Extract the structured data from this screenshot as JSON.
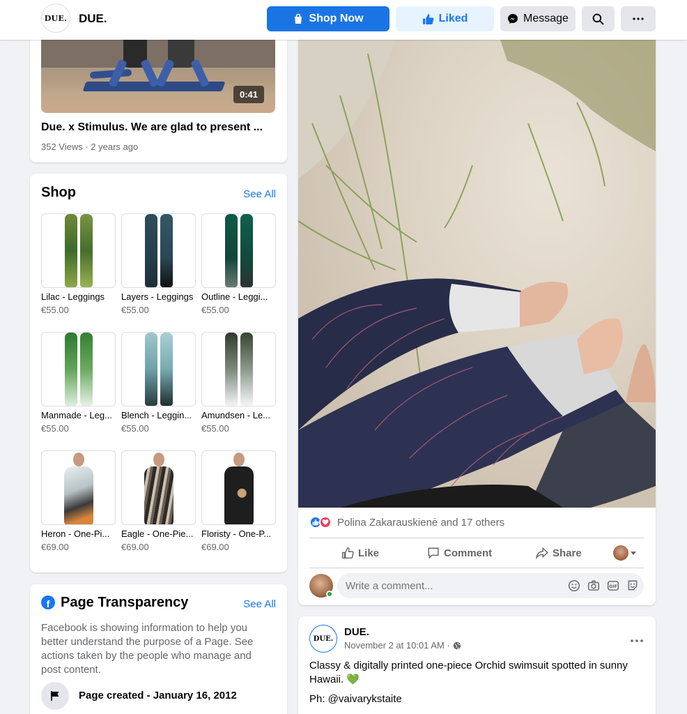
{
  "header": {
    "logo_text": "DUE.",
    "page_name": "DUE.",
    "shop_now": "Shop Now",
    "liked": "Liked",
    "message": "Message"
  },
  "video": {
    "duration": "0:41",
    "title": "Due. x Stimulus. We are glad to present ...",
    "meta": "352 Views · 2 years ago"
  },
  "shop": {
    "title": "Shop",
    "see_all": "See All",
    "products": [
      {
        "name": "Lilac - Leggings",
        "price": "€55.00"
      },
      {
        "name": "Layers - Leggings",
        "price": "€55.00"
      },
      {
        "name": "Outline - Leggi...",
        "price": "€55.00"
      },
      {
        "name": "Manmade - Leg...",
        "price": "€55.00"
      },
      {
        "name": "Blench - Leggin...",
        "price": "€55.00"
      },
      {
        "name": "Amundsen - Le...",
        "price": "€55.00"
      },
      {
        "name": "Heron - One-Pi...",
        "price": "€69.00"
      },
      {
        "name": "Eagle - One-Pie...",
        "price": "€69.00"
      },
      {
        "name": "Floristy - One-P...",
        "price": "€69.00"
      }
    ]
  },
  "transparency": {
    "title": "Page Transparency",
    "see_all": "See All",
    "description": "Facebook is showing information to help you better understand the purpose of a Page. See actions taken by the people who manage and post content.",
    "page_created": "Page created - January 16, 2012"
  },
  "post": {
    "reactions_text": "Polina Zakarauskienė and 17 others",
    "actions": {
      "like": "Like",
      "comment": "Comment",
      "share": "Share"
    },
    "comment_placeholder": "Write a comment..."
  },
  "post2": {
    "avatar_text": "DUE.",
    "author": "DUE.",
    "time": "November 2 at 10:01 AM ·",
    "text": "Classy & digitally printed one-piece Orchid swimsuit spotted in sunny Hawaii. 💚",
    "photo_credit": "Ph: @vaivarykstaite"
  },
  "colors": {
    "brand_blue": "#1b74e4",
    "liked_bg": "#e7f3ff",
    "page_bg": "#f0f2f5",
    "secondary_text": "#65676b"
  }
}
